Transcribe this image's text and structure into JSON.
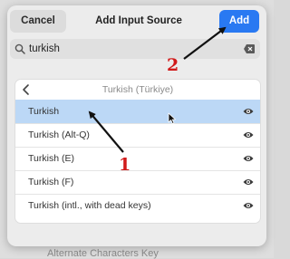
{
  "dialog": {
    "title": "Add Input Source",
    "cancel_label": "Cancel",
    "add_label": "Add"
  },
  "search": {
    "value": "turkish"
  },
  "list": {
    "header_title": "Turkish (Türkiye)",
    "items": [
      {
        "label": "Turkish",
        "selected": true
      },
      {
        "label": "Turkish (Alt-Q)",
        "selected": false
      },
      {
        "label": "Turkish (E)",
        "selected": false
      },
      {
        "label": "Turkish (F)",
        "selected": false
      },
      {
        "label": "Turkish (intl., with dead keys)",
        "selected": false
      }
    ]
  },
  "background": {
    "bottom_text": "Alternate Characters Key"
  },
  "annotations": {
    "label_1": "1",
    "label_2": "2"
  },
  "colors": {
    "accent": "#2979f2",
    "selected_row": "#bcd8f6",
    "annotation": "#d11a1a"
  }
}
